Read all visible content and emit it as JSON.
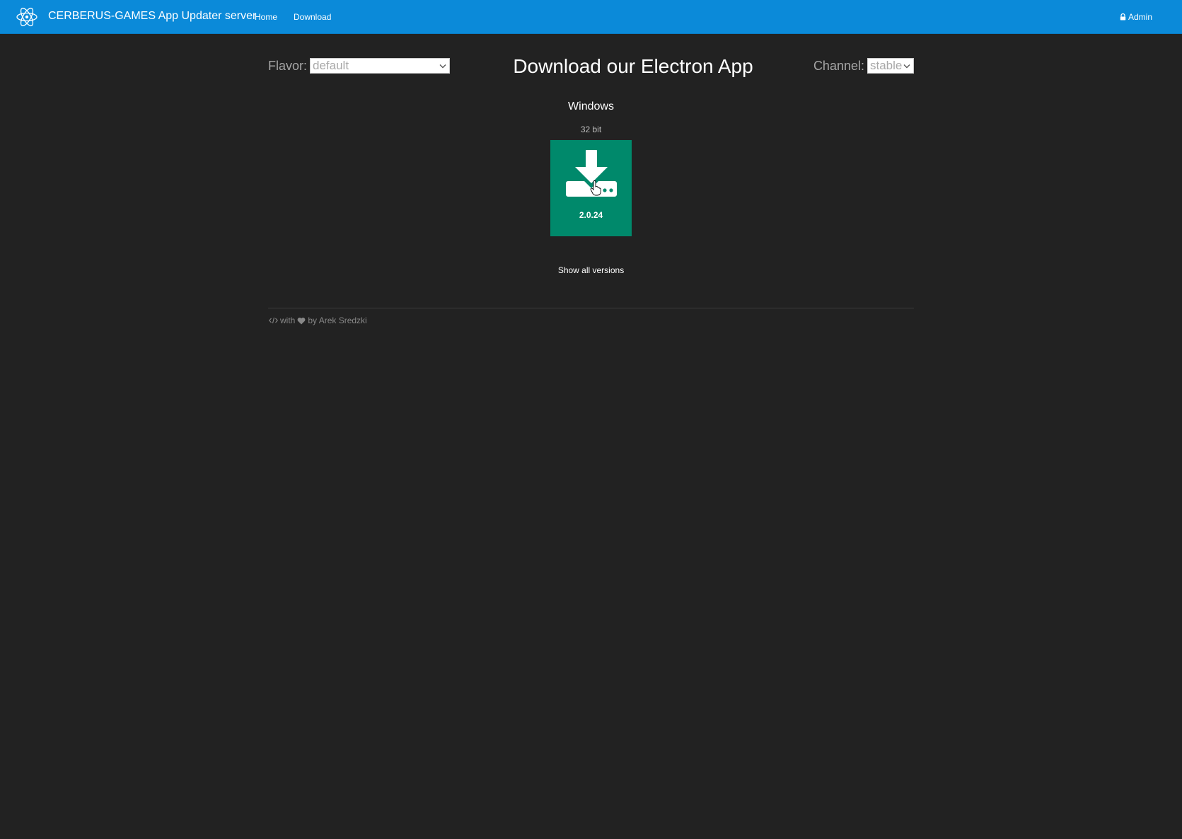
{
  "navbar": {
    "logo_icon": "electron-atom-icon",
    "brand_title": "CERBERUS-GAMES App Updater server",
    "links": {
      "home": "Home",
      "download": "Download"
    },
    "admin": {
      "icon": "lock-icon",
      "label": "Admin"
    },
    "background_color": "#0b8ad9"
  },
  "controls": {
    "flavor": {
      "label": "Flavor:",
      "selected": "default"
    },
    "channel": {
      "label": "Channel:",
      "selected": "stable"
    }
  },
  "main": {
    "title": "Download our Electron App",
    "platform": {
      "name": "Windows",
      "arch": "32 bit",
      "version": "2.0.24",
      "icon": "download-drive-icon",
      "tile_color": "#00896b"
    },
    "show_all_label": "Show all versions"
  },
  "footer": {
    "code_icon": "code-icon",
    "with_text": "with",
    "heart_icon": "heart-icon",
    "by_text": "by Arek Sredzki"
  },
  "page": {
    "background_color": "#222222"
  }
}
